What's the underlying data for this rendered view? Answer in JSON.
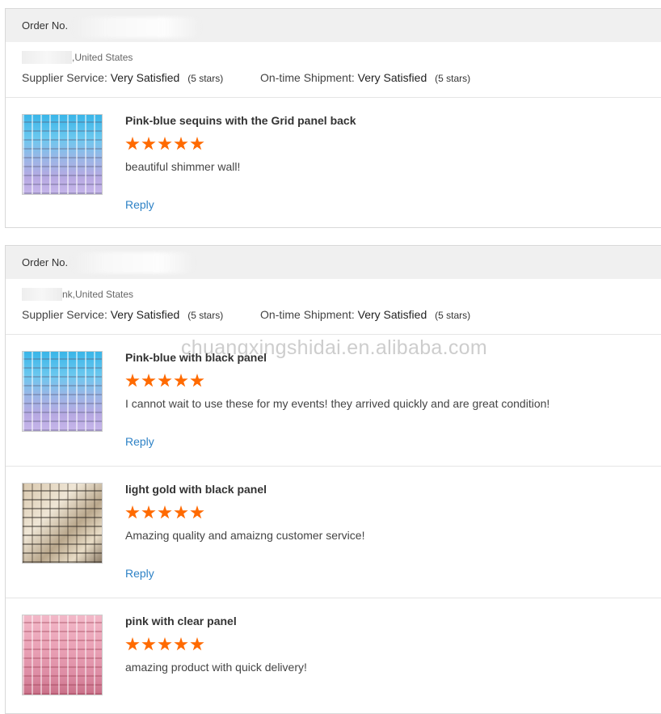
{
  "reviews": [
    {
      "order_label": "Order No.",
      "buyer_location": ",United States",
      "supplier_service_label": "Supplier Service:",
      "supplier_service_value": "Very Satisfied",
      "supplier_service_stars": "(5 stars)",
      "shipment_label": "On-time Shipment:",
      "shipment_value": "Very Satisfied",
      "shipment_stars": "(5 stars)",
      "items": [
        {
          "title": "Pink-blue sequins with the Grid panel back",
          "rating": 5,
          "comment": "beautiful shimmer wall!",
          "reply_label": "Reply",
          "thumb_icon": "sequin-panel-blue-image"
        }
      ]
    },
    {
      "order_label": "Order No.",
      "buyer_location": "nk,United States",
      "supplier_service_label": "Supplier Service:",
      "supplier_service_value": "Very Satisfied",
      "supplier_service_stars": "(5 stars)",
      "shipment_label": "On-time Shipment:",
      "shipment_value": "Very Satisfied",
      "shipment_stars": "(5 stars)",
      "items": [
        {
          "title": "Pink-blue with black panel",
          "rating": 5,
          "comment": "I cannot wait to use these for my events! they arrived quickly and are great condition!",
          "reply_label": "Reply",
          "thumb_icon": "sequin-panel-blue-image"
        },
        {
          "title": "light gold with black panel",
          "rating": 5,
          "comment": "Amazing quality and amaizng customer service!",
          "reply_label": "Reply",
          "thumb_icon": "sequin-panel-gold-image"
        },
        {
          "title": "pink with clear panel",
          "rating": 5,
          "comment": "amazing product with quick delivery!",
          "reply_label": "Reply",
          "thumb_icon": "sequin-panel-pink-image"
        }
      ]
    }
  ],
  "watermark": "chuangxingshidai.en.alibaba.com",
  "colors": {
    "star": "#ff6a00",
    "reply_link": "#2e82c6",
    "header_bg": "#f0f0f0"
  }
}
